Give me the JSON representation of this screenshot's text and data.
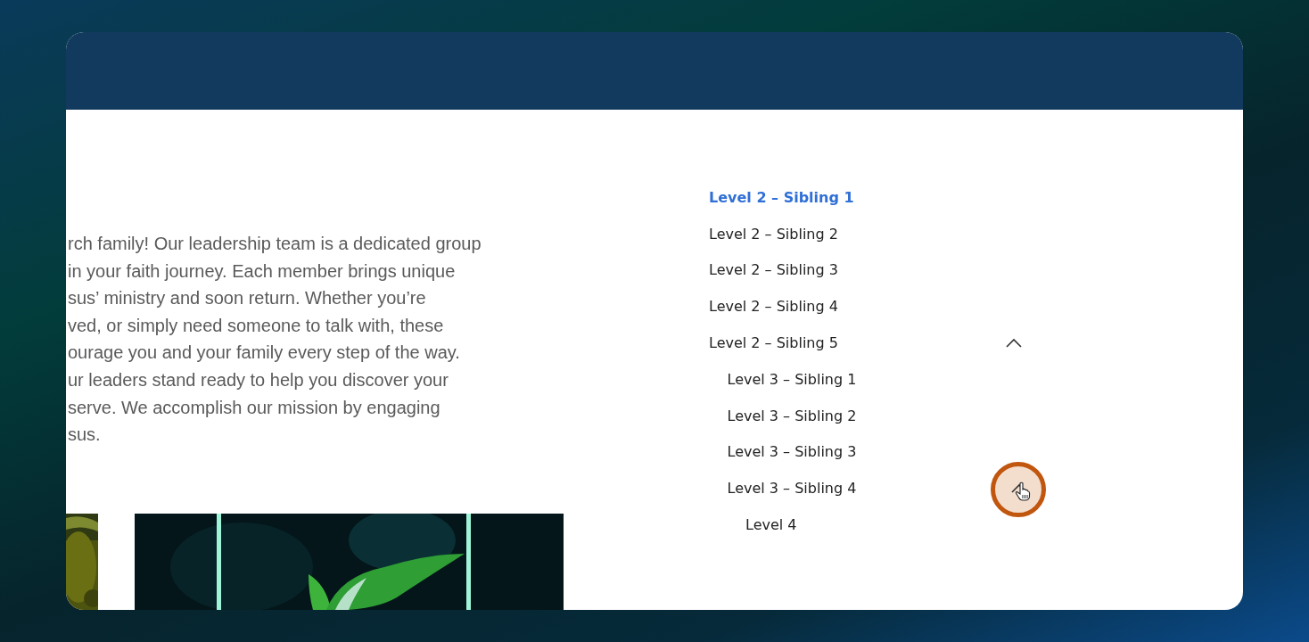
{
  "content": {
    "paragraph_lines": [
      "rch family! Our leadership team is a dedicated group",
      "in your faith journey. Each member brings unique",
      "sus’ ministry and soon return. Whether you’re",
      "ved, or simply need someone to talk with, these",
      "ourage you and your family every step of the way.",
      "ur leaders stand ready to help you discover your",
      "serve. We accomplish our mission by engaging",
      "sus."
    ]
  },
  "nav": {
    "items": [
      {
        "label": "Level 2 – Sibling 1",
        "selected": true
      },
      {
        "label": "Level 2 – Sibling 2",
        "selected": false
      },
      {
        "label": "Level 2 – Sibling 3",
        "selected": false
      },
      {
        "label": "Level 2 – Sibling 4",
        "selected": false
      },
      {
        "label": "Level 2 – Sibling 5",
        "selected": false,
        "expanded": true,
        "children": [
          {
            "label": "Level 3 – Sibling 1",
            "selected": false
          },
          {
            "label": "Level 3 – Sibling 2",
            "selected": false
          },
          {
            "label": "Level 3 – Sibling 3",
            "selected": false
          },
          {
            "label": "Level 3 – Sibling 4",
            "selected": false,
            "expanded": true,
            "hovered": true,
            "children": [
              {
                "label": "Level 4",
                "selected": false
              }
            ]
          }
        ]
      }
    ]
  }
}
